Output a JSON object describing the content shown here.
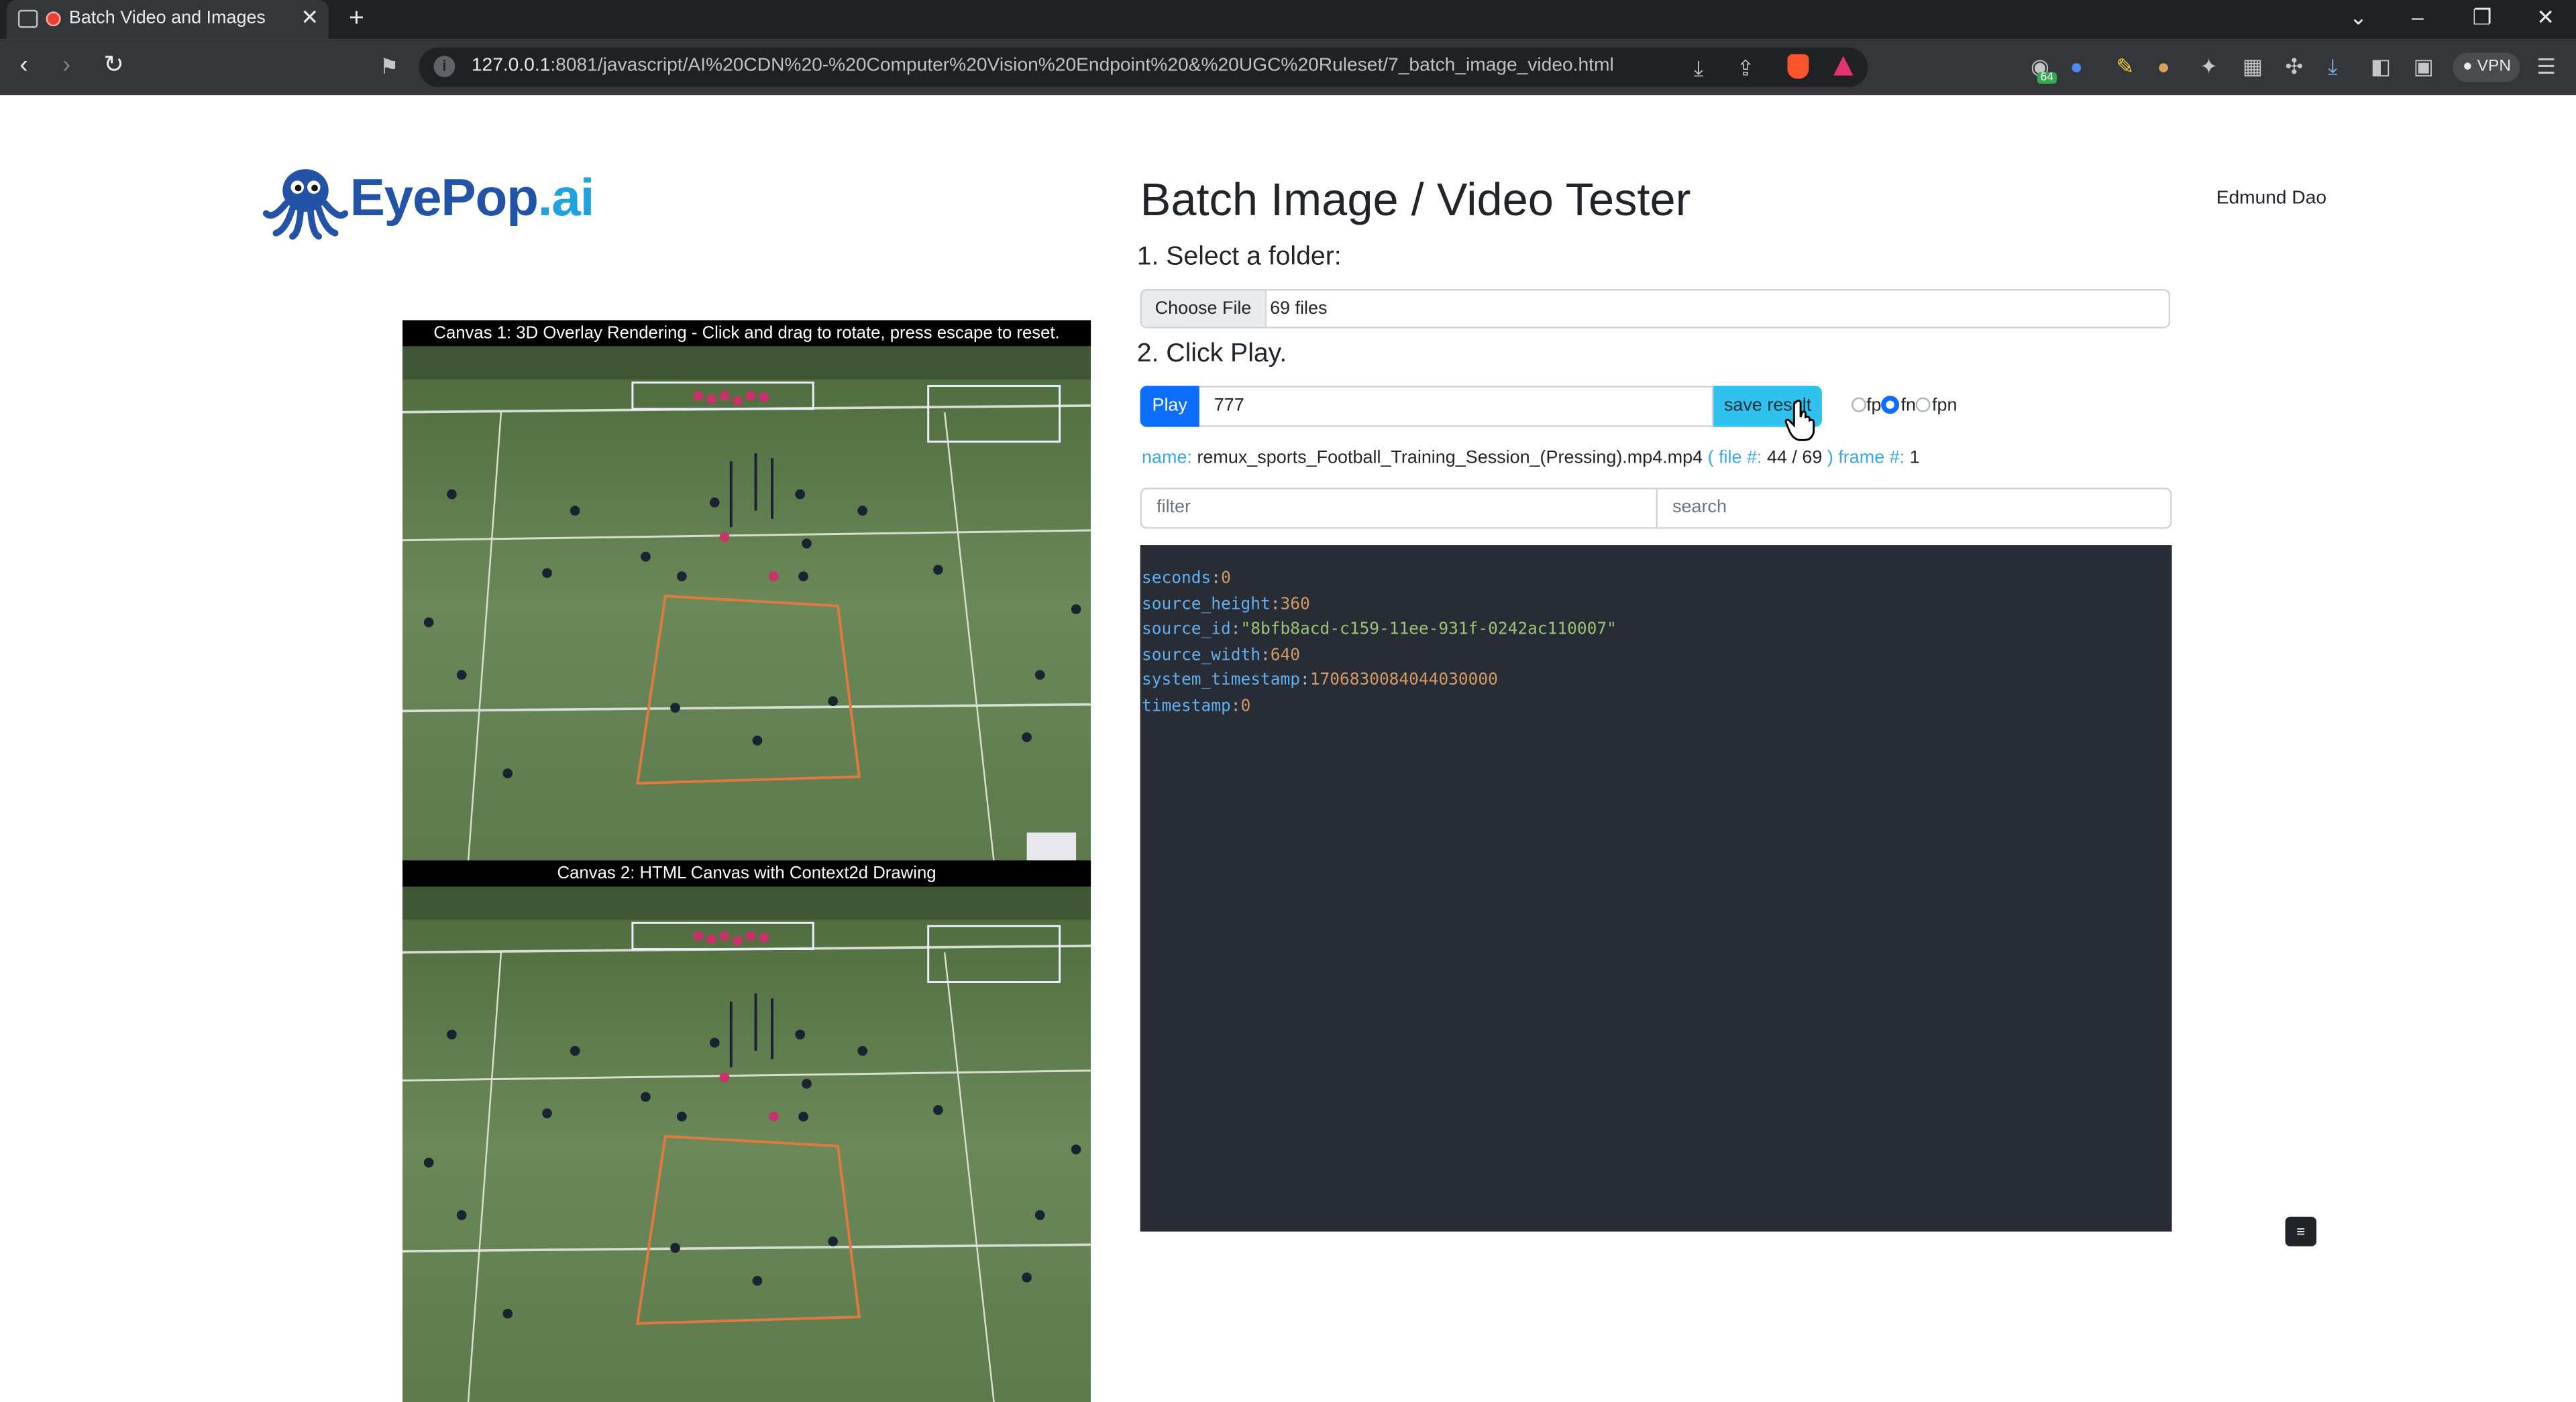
{
  "browser": {
    "tab_title": "Batch Video and Images",
    "url_host": "127.0.0.1",
    "url_rest": ":8081/javascript/AI%20CDN%20-%20Computer%20Vision%20Endpoint%20&%20UGC%20Ruleset/7_batch_image_video.html",
    "extension_badge": "64",
    "vpn_label": "VPN"
  },
  "logo": {
    "text_main": "EyePop",
    "text_suffix": ".ai"
  },
  "page": {
    "title": "Batch Image / Video Tester",
    "user_name": "Edmund Dao",
    "step1": "1. Select a folder:",
    "step2": "2. Click Play."
  },
  "canvases": {
    "canvas1_caption": "Canvas 1: 3D Overlay Rendering - Click and drag to rotate, press escape to reset.",
    "canvas2_caption": "Canvas 2: HTML Canvas with Context2d Drawing"
  },
  "file_input": {
    "button_label": "Choose File",
    "value": "69 files"
  },
  "controls": {
    "play_label": "Play",
    "number_value": "777",
    "save_label": "save result",
    "radios": [
      {
        "label": "fp",
        "checked": false
      },
      {
        "label": "fn",
        "checked": true
      },
      {
        "label": "fpn",
        "checked": false
      }
    ]
  },
  "status": {
    "name_key": "name:",
    "name_value": "remux_sports_Football_Training_Session_(Pressing).mp4.mp4",
    "file_key": "( file #:",
    "file_value": "44 / 69",
    "frame_key": ") frame #:",
    "frame_value": "1"
  },
  "filters": {
    "filter_placeholder": "filter",
    "search_placeholder": "search"
  },
  "result_json": [
    {
      "key": "seconds",
      "value": "0",
      "type": "number"
    },
    {
      "key": "source_height",
      "value": "360",
      "type": "number"
    },
    {
      "key": "source_id",
      "value": "\"8bfb8acd-c159-11ee-931f-0242ac110007\"",
      "type": "string"
    },
    {
      "key": "source_width",
      "value": "640",
      "type": "number"
    },
    {
      "key": "system_timestamp",
      "value": "1706830084044030000",
      "type": "number"
    },
    {
      "key": "timestamp",
      "value": "0",
      "type": "number"
    }
  ],
  "colors": {
    "primary": "#0d6efd",
    "info": "#2fc2ee",
    "code_bg": "#282c34",
    "field_green": "#5f7d4a"
  },
  "menu_icon_glyph": "≡"
}
